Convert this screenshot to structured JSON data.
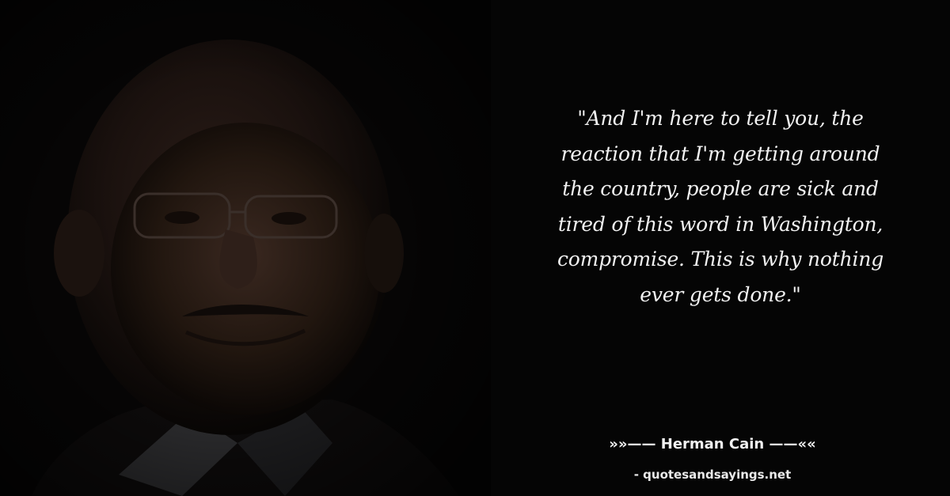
{
  "quote": {
    "lines": [
      "\"And I'm here to tell you, the",
      "reaction that I'm getting around",
      "the country, people are sick and",
      "tired of this word in Washington,",
      "compromise. This is why nothing",
      "ever gets done.\""
    ]
  },
  "attribution": {
    "author": "»»—— Herman Cain ——««",
    "source": "- quotesandsayings.net"
  },
  "colors": {
    "background": "#050505",
    "text": "#f2f2f2"
  }
}
